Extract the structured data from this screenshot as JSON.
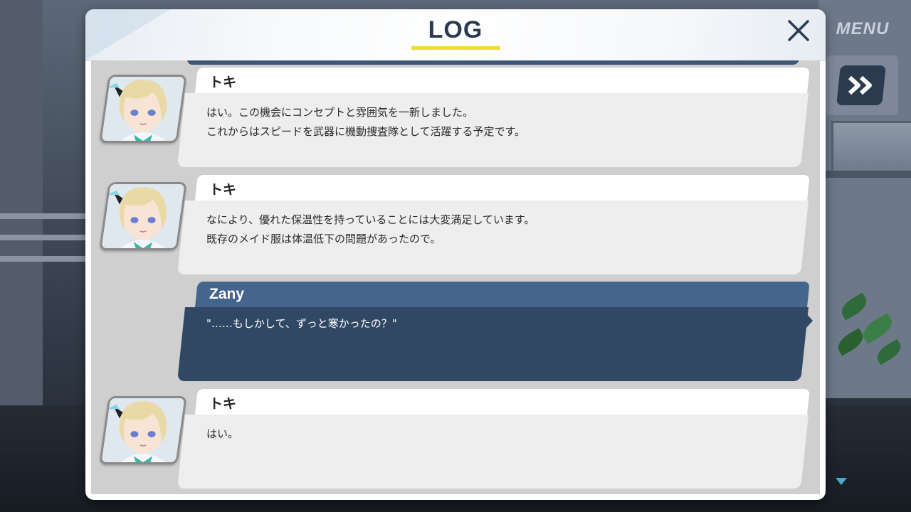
{
  "hud": {
    "menu_label": "MENU",
    "fast_forward_icon": "double-chevron-right-icon",
    "scroll_down_icon": "triangle-down-icon"
  },
  "log": {
    "title": "LOG",
    "close_icon": "close-icon",
    "accent_color": "#f1dc2e",
    "entries": [
      {
        "speaker": "トキ",
        "text": "はい。この機会にコンセプトと雰囲気を一新しました。\nこれからはスピードを武器に機動捜査隊として活躍する予定です。",
        "avatar": "toki-portrait"
      },
      {
        "speaker": "トキ",
        "text": "なにより、優れた保温性を持っていることには大変満足しています。\n既存のメイド服は体温低下の問題があったので。",
        "avatar": "toki-portrait"
      },
      {
        "speaker": "Zany",
        "text": "\"……もしかして、ずっと寒かったの？\"",
        "is_player": true
      },
      {
        "speaker": "トキ",
        "text": "はい。",
        "avatar": "toki-portrait"
      }
    ]
  },
  "colors": {
    "player_name_bar": "#45668c",
    "player_message": "#314865",
    "npc_message": "#eeeeee"
  }
}
